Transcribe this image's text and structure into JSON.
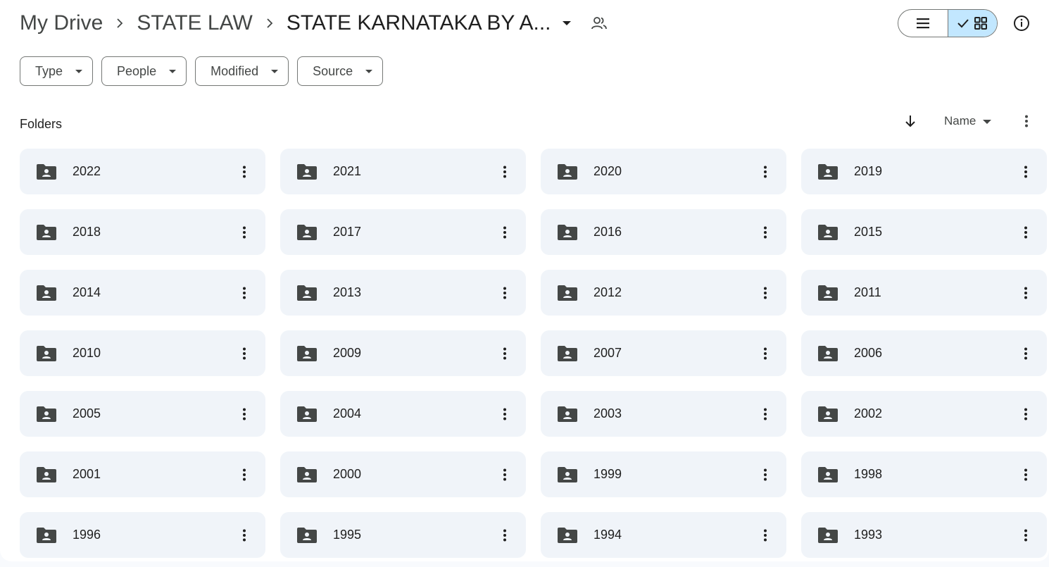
{
  "breadcrumb": {
    "items": [
      "My Drive",
      "STATE LAW"
    ],
    "current": "STATE KARNATAKA BY A..."
  },
  "view": {
    "mode": "grid"
  },
  "filters": [
    "Type",
    "People",
    "Modified",
    "Source"
  ],
  "section": {
    "title": "Folders",
    "sort_field": "Name",
    "sort_direction": "descending"
  },
  "folders": [
    "2022",
    "2021",
    "2020",
    "2019",
    "2018",
    "2017",
    "2016",
    "2015",
    "2014",
    "2013",
    "2012",
    "2011",
    "2010",
    "2009",
    "2007",
    "2006",
    "2005",
    "2004",
    "2003",
    "2002",
    "2001",
    "2000",
    "1999",
    "1998",
    "1996",
    "1995",
    "1994",
    "1993"
  ],
  "icons": {
    "folder": "shared-folder-icon",
    "more": "more-vert-icon",
    "info": "info-icon",
    "shared": "people-icon"
  },
  "colors": {
    "folder_bg": "#f0f4f9",
    "active_toggle": "#c2e7ff",
    "icon": "#444746"
  }
}
